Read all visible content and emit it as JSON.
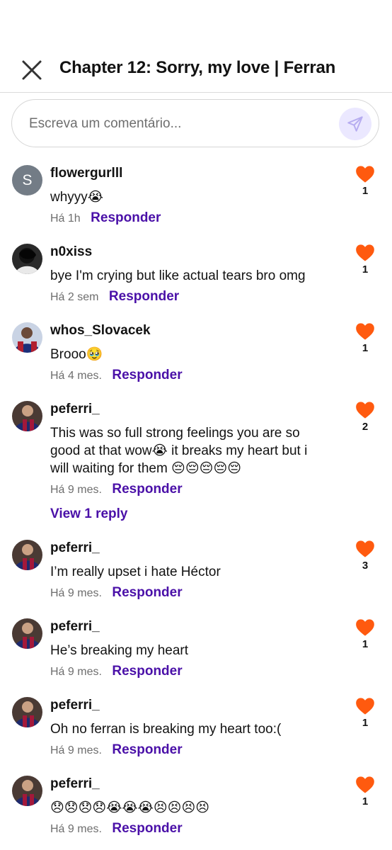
{
  "header": {
    "title": "Chapter 12: Sorry, my love | Ferran"
  },
  "comment_input": {
    "placeholder": "Escreva um comentário..."
  },
  "reply_label": "Responder",
  "comments": [
    {
      "avatar_letter": "S",
      "username": "flowergurlll",
      "text": "whyyy😭",
      "time": "Há 1h",
      "likes": "1"
    },
    {
      "username": "n0xiss",
      "text": "bye I'm crying but like actual tears bro omg",
      "time": "Há 2 sem",
      "likes": "1"
    },
    {
      "username": "whos_Slovacek",
      "text": "Brooo🥹",
      "time": "Há 4 mes.",
      "likes": "1"
    },
    {
      "username": "peferri_",
      "text": "This was so full strong feelings you are so good at that wow😭 it breaks my heart but i will waiting for them 😔😔😔😔😔",
      "time": "Há 9 mes.",
      "likes": "2",
      "view_replies": "View 1 reply"
    },
    {
      "username": "peferri_",
      "text": "I’m really upset i hate Héctor",
      "time": "Há 9 mes.",
      "likes": "3"
    },
    {
      "username": "peferri_",
      "text": "He’s breaking my heart",
      "time": "Há 9 mes.",
      "likes": "1"
    },
    {
      "username": "peferri_",
      "text": "Oh no ferran is breaking my heart too:(",
      "time": "Há 9 mes.",
      "likes": "1"
    },
    {
      "username": "peferri_",
      "text": "😞😞😞😞😭😭😭😣😣😣😣",
      "time": "Há 9 mes.",
      "likes": "1"
    }
  ],
  "colors": {
    "accent": "#4a10a8",
    "heart": "#ff5a0f",
    "send_bg": "#ebe8ff"
  }
}
